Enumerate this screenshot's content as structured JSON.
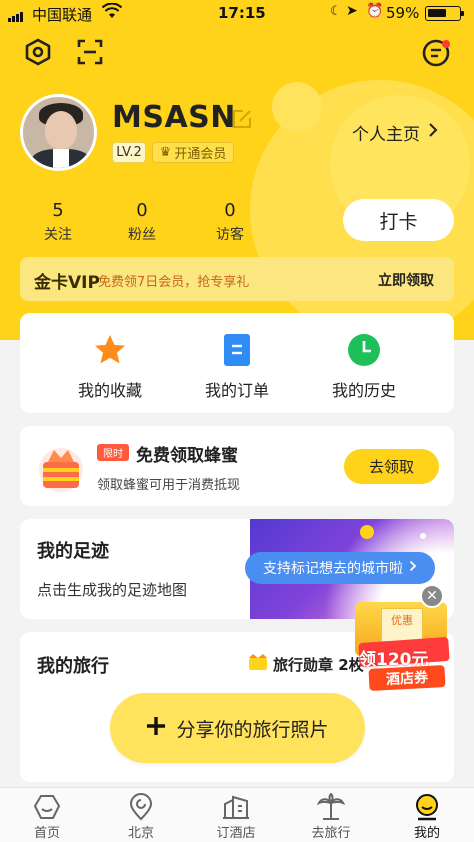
{
  "status_bar": {
    "carrier": "中国联通",
    "time": "17:15",
    "battery": "59%"
  },
  "profile": {
    "username": "MSASN",
    "level": "LV.2",
    "vip_label": "开通会员",
    "homepage_link": "个人主页",
    "stats": [
      {
        "count": "5",
        "label": "关注"
      },
      {
        "count": "0",
        "label": "粉丝"
      },
      {
        "count": "0",
        "label": "访客"
      }
    ],
    "checkin_button": "打卡"
  },
  "vip_bar": {
    "logo": "金卡VIP",
    "text": "免费领7日会员，抢专享礼",
    "action": "立即领取"
  },
  "shortcuts": [
    {
      "label": "我的收藏",
      "icon": "star-icon"
    },
    {
      "label": "我的订单",
      "icon": "document-icon"
    },
    {
      "label": "我的历史",
      "icon": "clock-icon"
    }
  ],
  "honey_card": {
    "tag": "限时",
    "title": "免费领取蜂蜜",
    "subtitle": "领取蜂蜜可用于消费抵现",
    "button": "去领取"
  },
  "footprint_card": {
    "title": "我的足迹",
    "subtitle": "点击生成我的足迹地图",
    "tooltip": "支持标记想去的城市啦"
  },
  "trip_card": {
    "title": "我的旅行",
    "medal_label": "旅行勋章 2枚",
    "share_button": "分享你的旅行照片"
  },
  "promo": {
    "ticket_text": "优惠",
    "line1": "领120元",
    "line2": "酒店券"
  },
  "tab_bar": [
    {
      "label": "首页",
      "icon": "home-icon"
    },
    {
      "label": "北京",
      "icon": "location-icon"
    },
    {
      "label": "订酒店",
      "icon": "hotel-icon"
    },
    {
      "label": "去旅行",
      "icon": "palm-tree-icon"
    },
    {
      "label": "我的",
      "icon": "profile-icon",
      "active": true
    }
  ],
  "colors": {
    "brand_yellow": "#ffd31a",
    "tooltip_blue": "#4a8ef0",
    "vip_orange": "#c6671a"
  }
}
